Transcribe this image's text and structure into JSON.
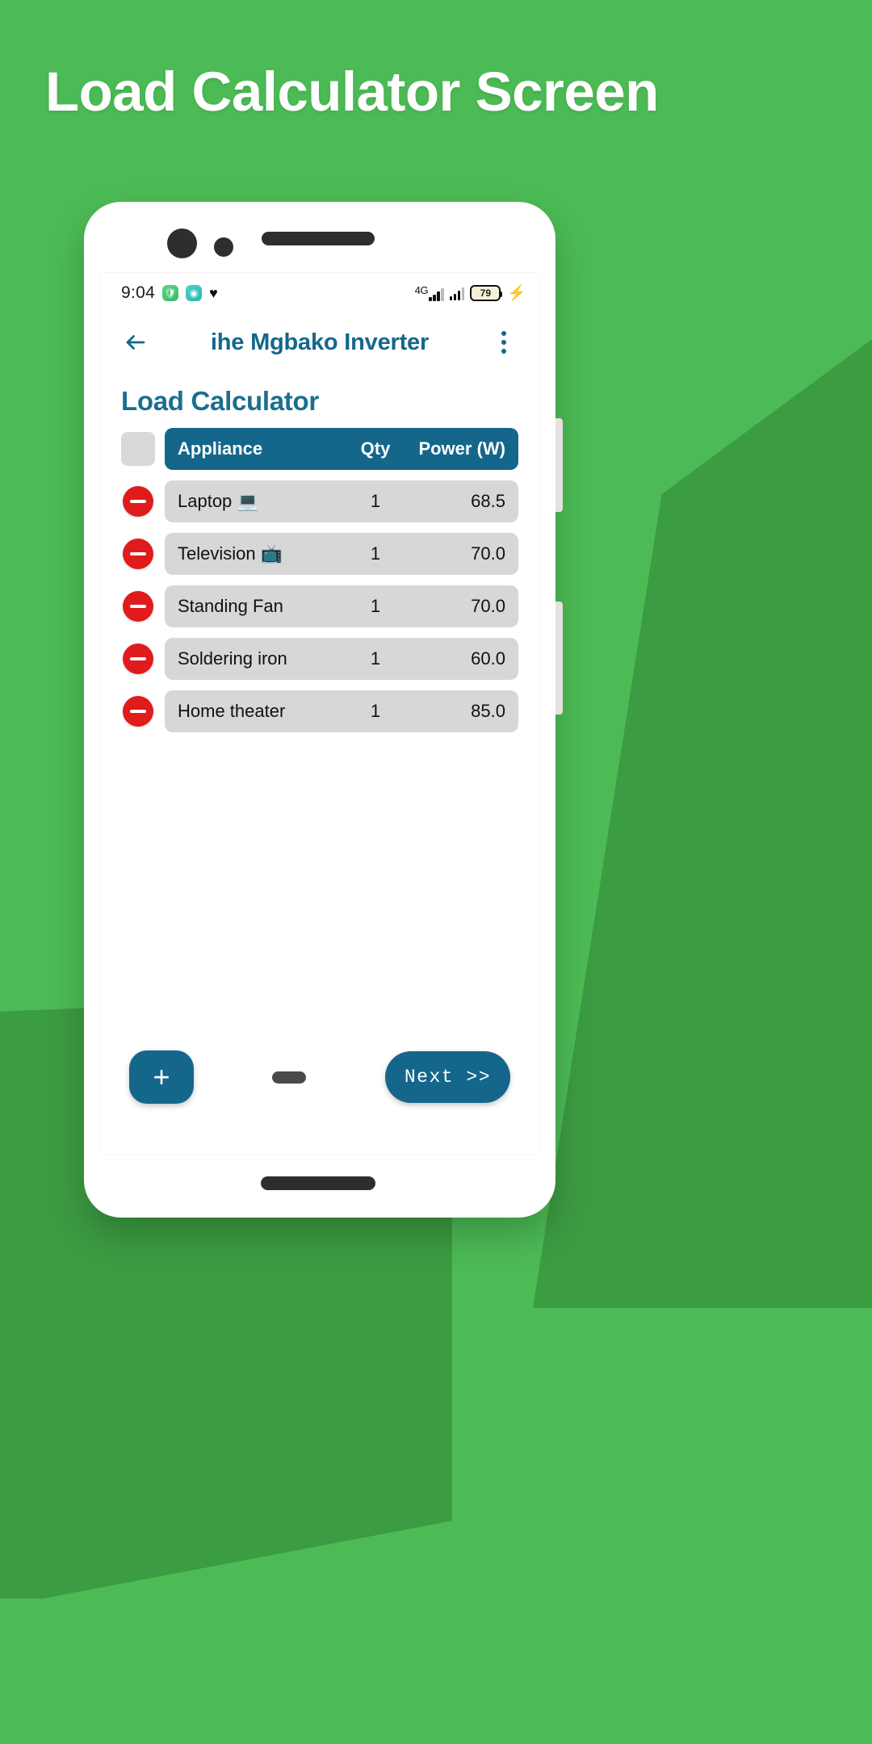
{
  "headline": "Load Calculator Screen",
  "colors": {
    "background_green": "#4CBB55",
    "background_green_dark": "#3C9C42",
    "accent_teal": "#14678B",
    "heading_teal": "#1B6E8F",
    "delete_red": "#E01B1B",
    "row_gray": "#D7D7D7",
    "header_placeholder_gray": "#D9D9D9"
  },
  "status_bar": {
    "time": "9:04",
    "app_icons": [
      "shield-app-icon",
      "camera-app-icon",
      "heart-icon"
    ],
    "network_label": "4G",
    "battery_percent": "79",
    "charging": true
  },
  "app_bar": {
    "back_icon": "back-arrow-icon",
    "title": "ihe Mgbako Inverter",
    "overflow_icon": "overflow-menu-icon"
  },
  "page": {
    "title": "Load Calculator"
  },
  "table": {
    "headers": {
      "appliance": "Appliance",
      "qty": "Qty",
      "power": "Power (W)"
    },
    "rows": [
      {
        "name": "Laptop 💻",
        "qty": "1",
        "power": "68.5"
      },
      {
        "name": "Television 📺",
        "qty": "1",
        "power": "70.0"
      },
      {
        "name": "Standing Fan",
        "qty": "1",
        "power": "70.0"
      },
      {
        "name": "Soldering iron",
        "qty": "1",
        "power": "60.0"
      },
      {
        "name": "Home theater",
        "qty": "1",
        "power": "85.0"
      }
    ]
  },
  "bottom_bar": {
    "add_label": "+",
    "next_label": "Next >>"
  }
}
